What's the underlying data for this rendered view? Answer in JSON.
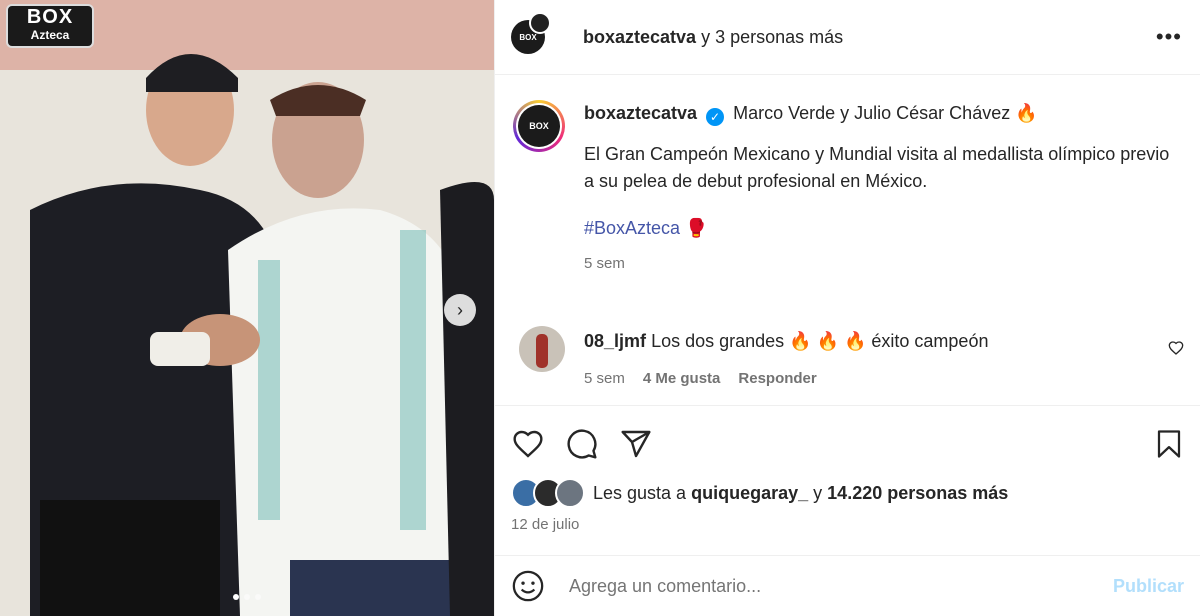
{
  "photo": {
    "logo_top": "BOX",
    "logo_bottom": "Azteca",
    "carousel_dots": 3,
    "active_dot": 0
  },
  "header": {
    "username": "boxaztecatva",
    "suffix": "y 3 personas más"
  },
  "caption": {
    "username": "boxaztecatva",
    "title": "Marco Verde y Julio César Chávez",
    "title_emoji": "🔥",
    "paragraph": "El Gran Campeón Mexicano y Mundial visita al medallista olímpico previo a su pelea de debut profesional en México.",
    "hashtag": "#BoxAzteca",
    "hashtag_emoji": "🥊",
    "time": "5 sem"
  },
  "comment": {
    "username": "08_ljmf",
    "text": "Los dos grandes 🔥 🔥 🔥 éxito campeón",
    "time": "5 sem",
    "likes": "4 Me gusta",
    "reply": "Responder"
  },
  "likes": {
    "prefix": "Les gusta a",
    "user": "quiquegaray_",
    "middle": "y",
    "count": "14.220 personas más"
  },
  "date": "12 de julio",
  "add_comment": {
    "placeholder": "Agrega un comentario...",
    "post": "Publicar"
  },
  "colors": {
    "link": "#4556a8",
    "muted": "#737373",
    "verified": "#0095f6",
    "post_disabled": "#b2dffc"
  }
}
